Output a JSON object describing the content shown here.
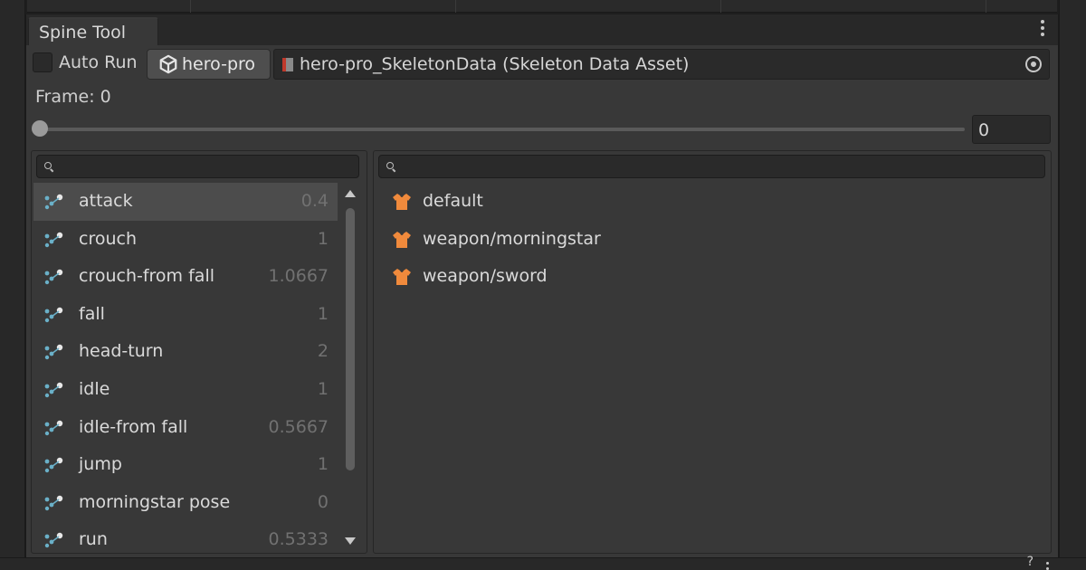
{
  "window": {
    "tab_label": "Spine Tool"
  },
  "toolbar": {
    "auto_run_label": "Auto Run",
    "auto_run_checked": false,
    "object_button_label": "hero-pro",
    "skeleton_field_value": "hero-pro_SkeletonData (Skeleton Data Asset)"
  },
  "frame": {
    "label": "Frame: 0",
    "slider_value": 0,
    "input_value": "0"
  },
  "animations": {
    "search_value": "",
    "selected_index": 0,
    "items": [
      {
        "name": "attack",
        "duration": "0.4"
      },
      {
        "name": "crouch",
        "duration": "1"
      },
      {
        "name": "crouch-from fall",
        "duration": "1.0667"
      },
      {
        "name": "fall",
        "duration": "1"
      },
      {
        "name": "head-turn",
        "duration": "2"
      },
      {
        "name": "idle",
        "duration": "1"
      },
      {
        "name": "idle-from fall",
        "duration": "0.5667"
      },
      {
        "name": "jump",
        "duration": "1"
      },
      {
        "name": "morningstar pose",
        "duration": "0"
      },
      {
        "name": "run",
        "duration": "0.5333"
      }
    ]
  },
  "skins": {
    "search_value": "",
    "items": [
      {
        "name": "default"
      },
      {
        "name": "weapon/morningstar"
      },
      {
        "name": "weapon/sword"
      }
    ]
  },
  "colors": {
    "skin_icon": "#f08a3c",
    "anim_icon": "#6ab0c8",
    "selected_row": "#4c4c4c"
  },
  "icons": {
    "kebab": "kebab-menu-icon",
    "object": "unity-gameobject-icon",
    "asset": "skeleton-data-asset-icon",
    "picker": "object-picker-icon",
    "search": "search-icon",
    "animation": "animation-bones-icon",
    "skin": "skin-shirt-icon"
  },
  "bottom": {
    "glyph": "?"
  }
}
